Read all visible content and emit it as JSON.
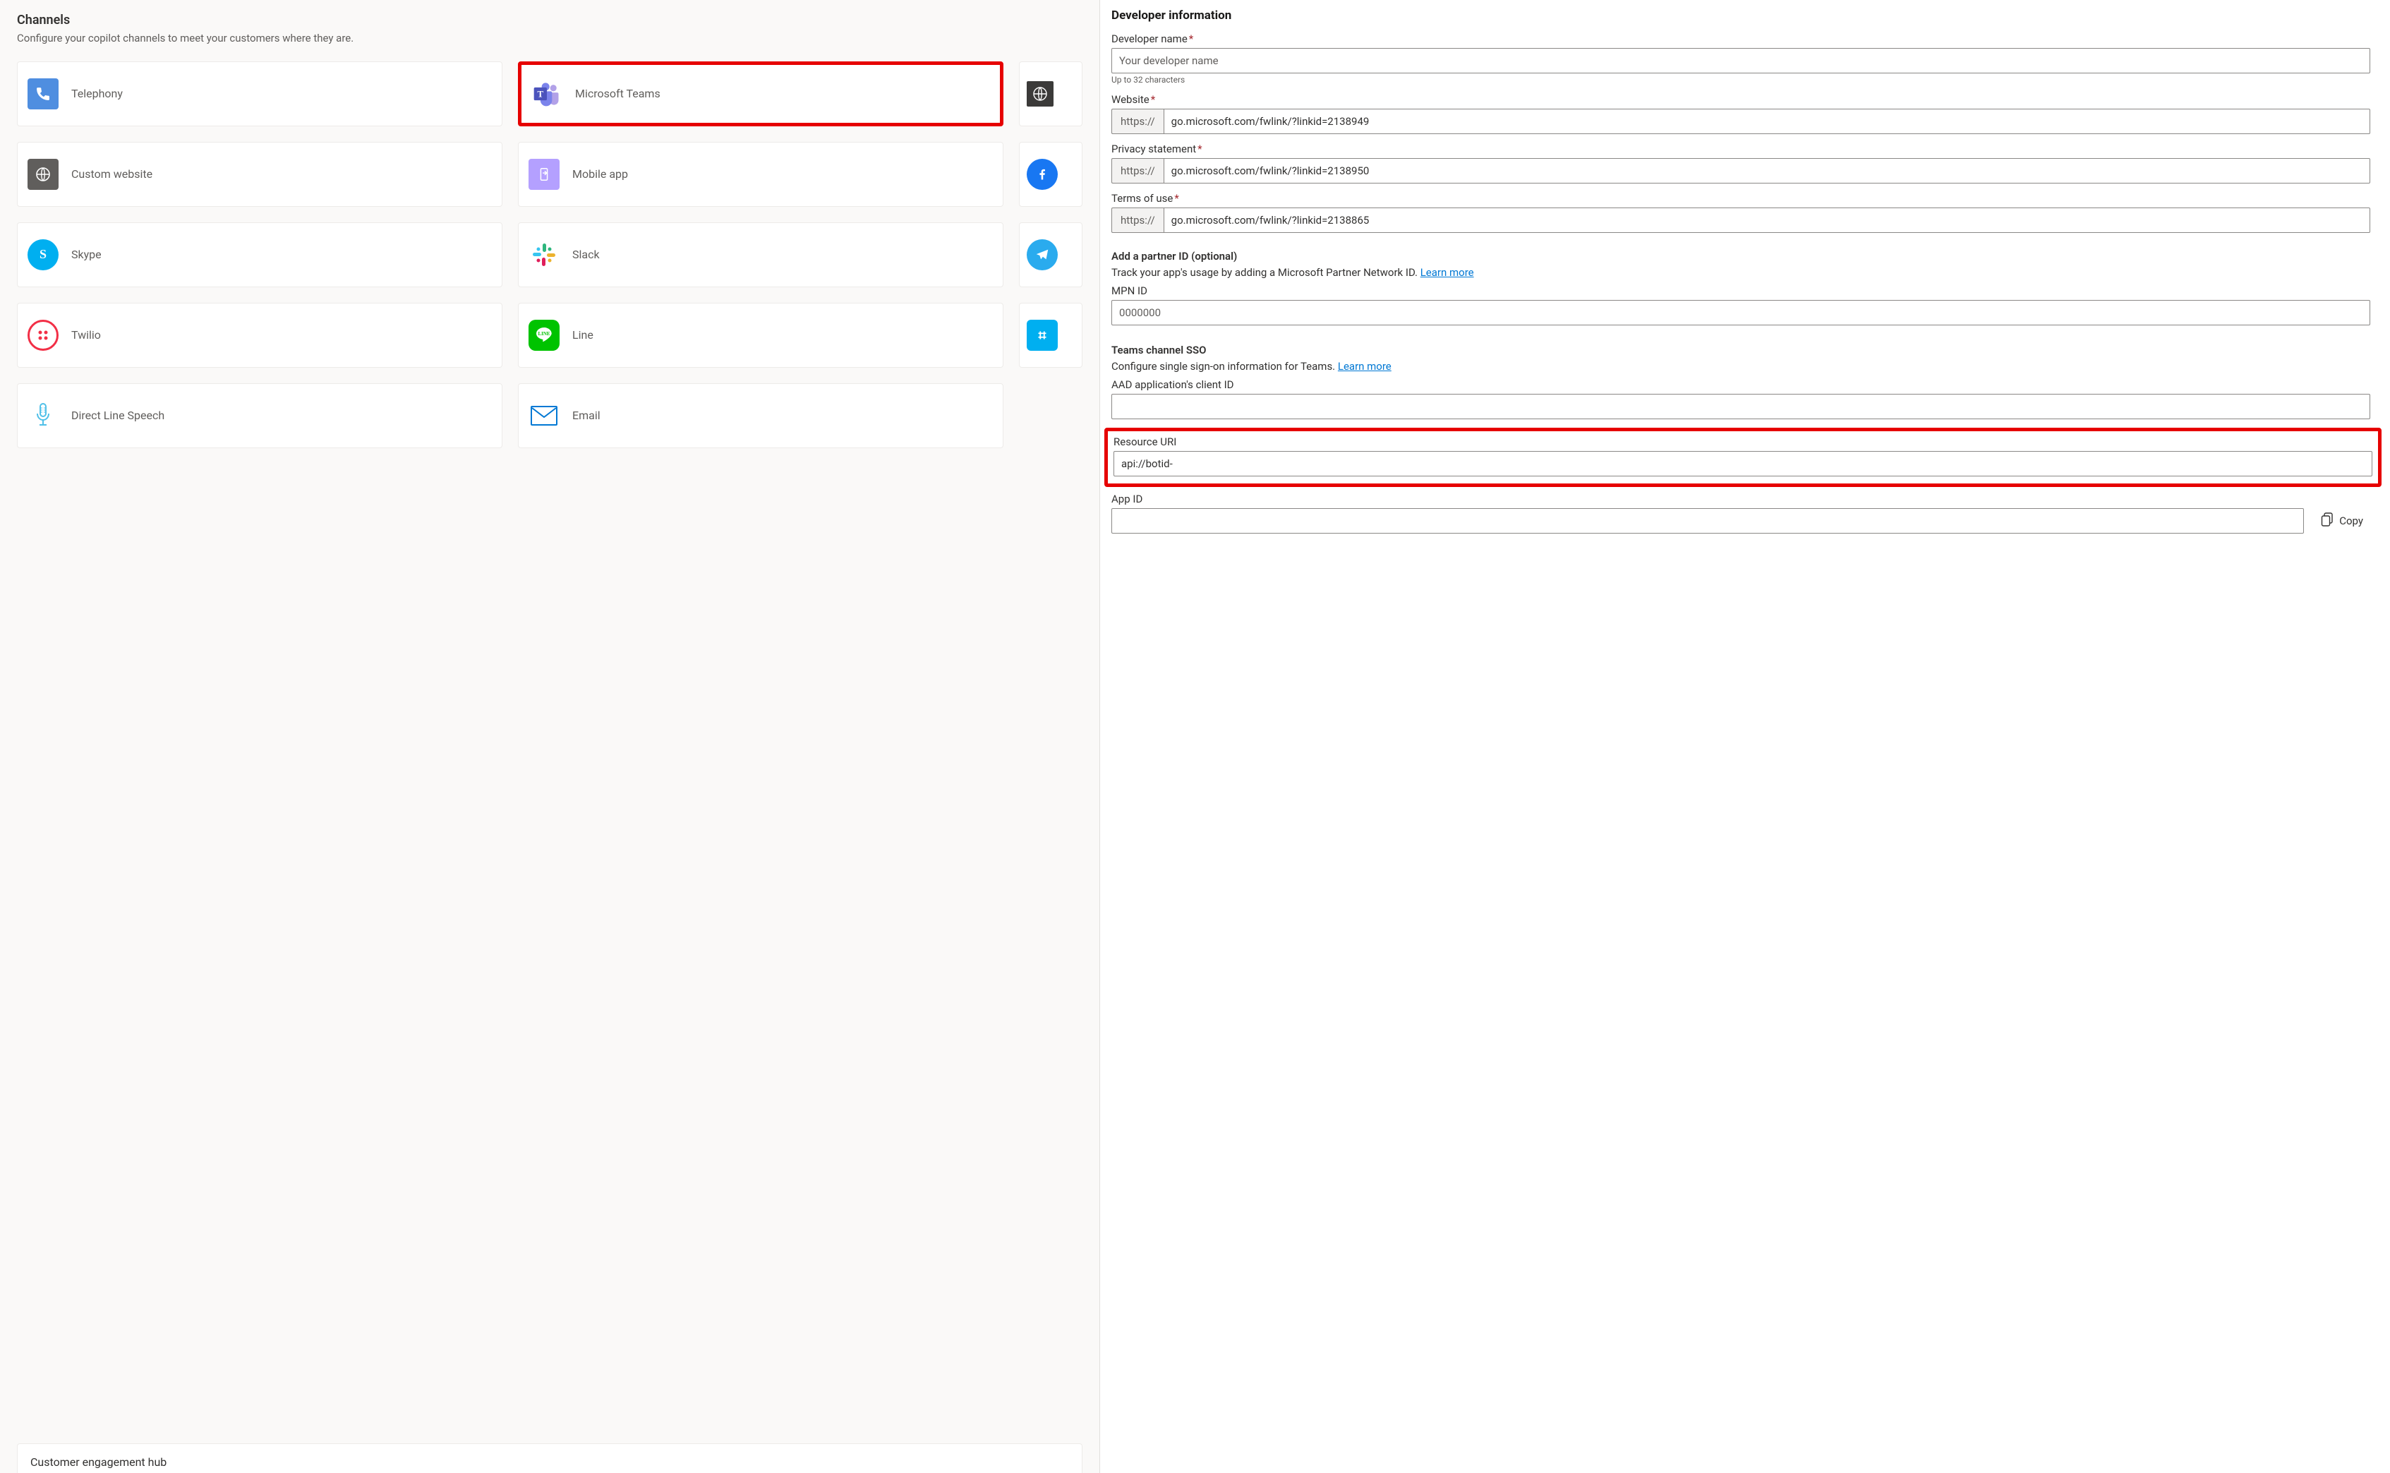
{
  "channels_panel": {
    "title": "Channels",
    "subtitle": "Configure your copilot channels to meet your customers where they are.",
    "cards": [
      {
        "label": "Telephony",
        "icon": "phone"
      },
      {
        "label": "Microsoft Teams",
        "icon": "teams"
      },
      {
        "label": "",
        "icon": "globe-dark"
      },
      {
        "label": "Custom website",
        "icon": "globe"
      },
      {
        "label": "Mobile app",
        "icon": "mobile"
      },
      {
        "label": "",
        "icon": "facebook"
      },
      {
        "label": "Skype",
        "icon": "skype"
      },
      {
        "label": "Slack",
        "icon": "slack"
      },
      {
        "label": "",
        "icon": "telegram-teal"
      },
      {
        "label": "Twilio",
        "icon": "twilio"
      },
      {
        "label": "Line",
        "icon": "line"
      },
      {
        "label": "",
        "icon": "groupme"
      },
      {
        "label": "Direct Line Speech",
        "icon": "mic"
      },
      {
        "label": "Email",
        "icon": "email"
      }
    ],
    "hub_title": "Customer engagement hub"
  },
  "form": {
    "section_title": "Developer information",
    "developer_name": {
      "label": "Developer name",
      "placeholder": "Your developer name",
      "helper": "Up to 32 characters"
    },
    "website": {
      "label": "Website",
      "prefix": "https://",
      "value": "go.microsoft.com/fwlink/?linkid=2138949"
    },
    "privacy": {
      "label": "Privacy statement",
      "prefix": "https://",
      "value": "go.microsoft.com/fwlink/?linkid=2138950"
    },
    "terms": {
      "label": "Terms of use",
      "prefix": "https://",
      "value": "go.microsoft.com/fwlink/?linkid=2138865"
    },
    "partner": {
      "title": "Add a partner ID (optional)",
      "desc_prefix": "Track your app's usage by adding a Microsoft Partner Network ID. ",
      "learn_more": "Learn more",
      "mpn_label": "MPN ID",
      "mpn_placeholder": "0000000"
    },
    "sso": {
      "title": "Teams channel SSO",
      "desc_prefix": "Configure single sign-on information for Teams. ",
      "learn_more": "Learn more",
      "client_id_label": "AAD application's client ID",
      "resource_uri_label": "Resource URI",
      "resource_uri_value": "api://botid-",
      "app_id_label": "App ID",
      "copy_label": "Copy"
    }
  }
}
